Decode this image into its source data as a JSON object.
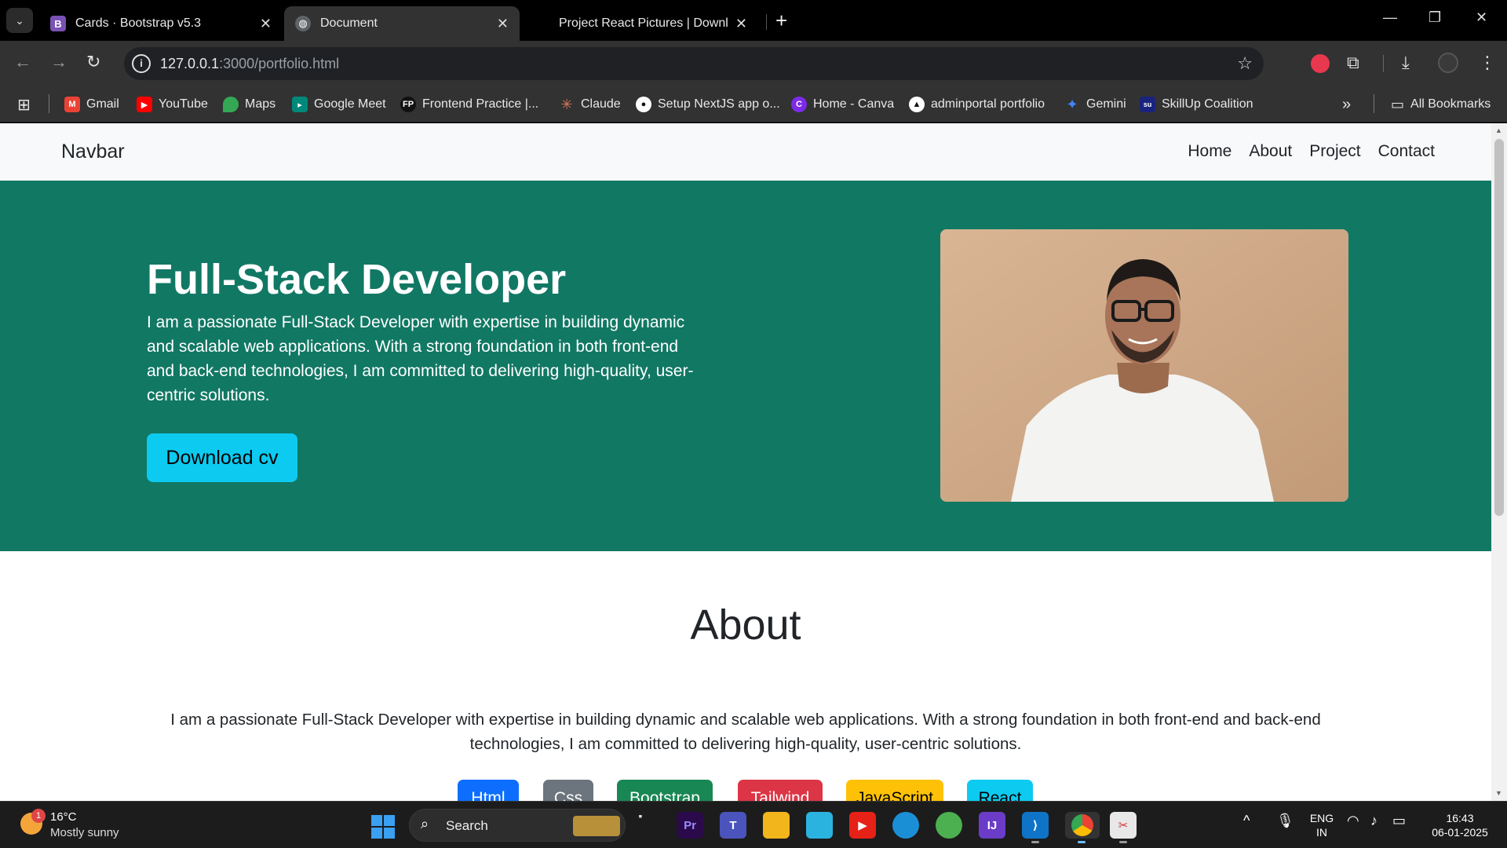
{
  "browser": {
    "tabs": [
      {
        "title": "Cards · Bootstrap v5.3",
        "favicon": "bootstrap-icon",
        "active": false
      },
      {
        "title": "Document",
        "favicon": "globe-icon",
        "active": true
      },
      {
        "title": "Project React Pictures | Downlo",
        "favicon": "none",
        "active": false
      }
    ],
    "url_host": "127.0.0.1",
    "url_rest": ":3000/portfolio.html",
    "bookmarks": [
      {
        "label": "Gmail",
        "icon": "gmail-icon",
        "color": "#ea4335"
      },
      {
        "label": "YouTube",
        "icon": "youtube-icon",
        "color": "#ff0000"
      },
      {
        "label": "Maps",
        "icon": "maps-icon",
        "color": "#34a853"
      },
      {
        "label": "Google Meet",
        "icon": "meet-icon",
        "color": "#00897b"
      },
      {
        "label": "Frontend Practice |...",
        "icon": "fp-icon",
        "color": "#111111"
      },
      {
        "label": "Claude",
        "icon": "claude-icon",
        "color": "#d97757"
      },
      {
        "label": "Setup NextJS app o...",
        "icon": "github-icon",
        "color": "#111111"
      },
      {
        "label": "Home - Canva",
        "icon": "canva-icon",
        "color": "#7d2ae8"
      },
      {
        "label": "adminportal portfolio",
        "icon": "vercel-icon",
        "color": "#111111"
      },
      {
        "label": "Gemini",
        "icon": "gemini-icon",
        "color": "#4285f4"
      },
      {
        "label": "SkillUp Coalition",
        "icon": "skillup-icon",
        "color": "#1a237e"
      }
    ],
    "all_bookmarks": "All Bookmarks"
  },
  "page": {
    "navbar": {
      "brand": "Navbar",
      "links": [
        "Home",
        "About",
        "Project",
        "Contact"
      ]
    },
    "hero": {
      "title": "Full-Stack Developer",
      "text": "I am a passionate Full-Stack Developer with expertise in building dynamic and scalable web applications. With a strong foundation in both front-end and back-end technologies, I am committed to delivering high-quality, user-centric solutions.",
      "button": "Download cv",
      "bg": "#117864"
    },
    "about": {
      "title": "About",
      "text": "I am a passionate Full-Stack Developer with expertise in building dynamic and scalable web applications. With a strong foundation in both front-end and back-end technologies, I am committed to delivering high-quality, user-centric solutions.",
      "skills": [
        {
          "label": "Html",
          "color": "#0d6efd"
        },
        {
          "label": "Css",
          "color": "#6c757d"
        },
        {
          "label": "Bootstrap",
          "color": "#198754"
        },
        {
          "label": "Tailwind",
          "color": "#dc3545"
        },
        {
          "label": "JavaScript",
          "color": "#ffc107"
        },
        {
          "label": "React",
          "color": "#0dcaf0"
        }
      ]
    }
  },
  "taskbar": {
    "weather_temp": "16°C",
    "weather_desc": "Mostly sunny",
    "weather_badge": "1",
    "search": "Search",
    "lang": "ENG",
    "region": "IN",
    "time": "16:43",
    "date": "06-01-2025"
  }
}
